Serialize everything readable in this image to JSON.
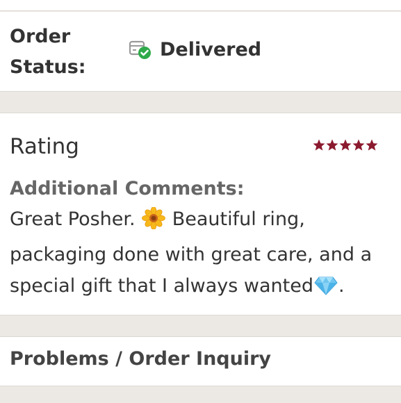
{
  "order": {
    "status_label_line1": "Order",
    "status_label_line2": "Status:",
    "status_value": "Delivered",
    "status_icon": "package-delivered-icon"
  },
  "rating": {
    "title": "Rating",
    "stars": 5,
    "star_color": "#8b1a2f",
    "comments_label": "Additional Comments:",
    "comment_part1": "Great Posher. ",
    "comment_part2": " Beautiful ring, packaging done with great care, and a special gift that I always wanted",
    "comment_part3": ".",
    "emoji_1": "sunflower-emoji",
    "emoji_2": "gem-emoji"
  },
  "problems": {
    "label": "Problems / Order Inquiry"
  },
  "colors": {
    "background": "#ece9e4",
    "card": "#ffffff",
    "check_green": "#2faa4a"
  }
}
